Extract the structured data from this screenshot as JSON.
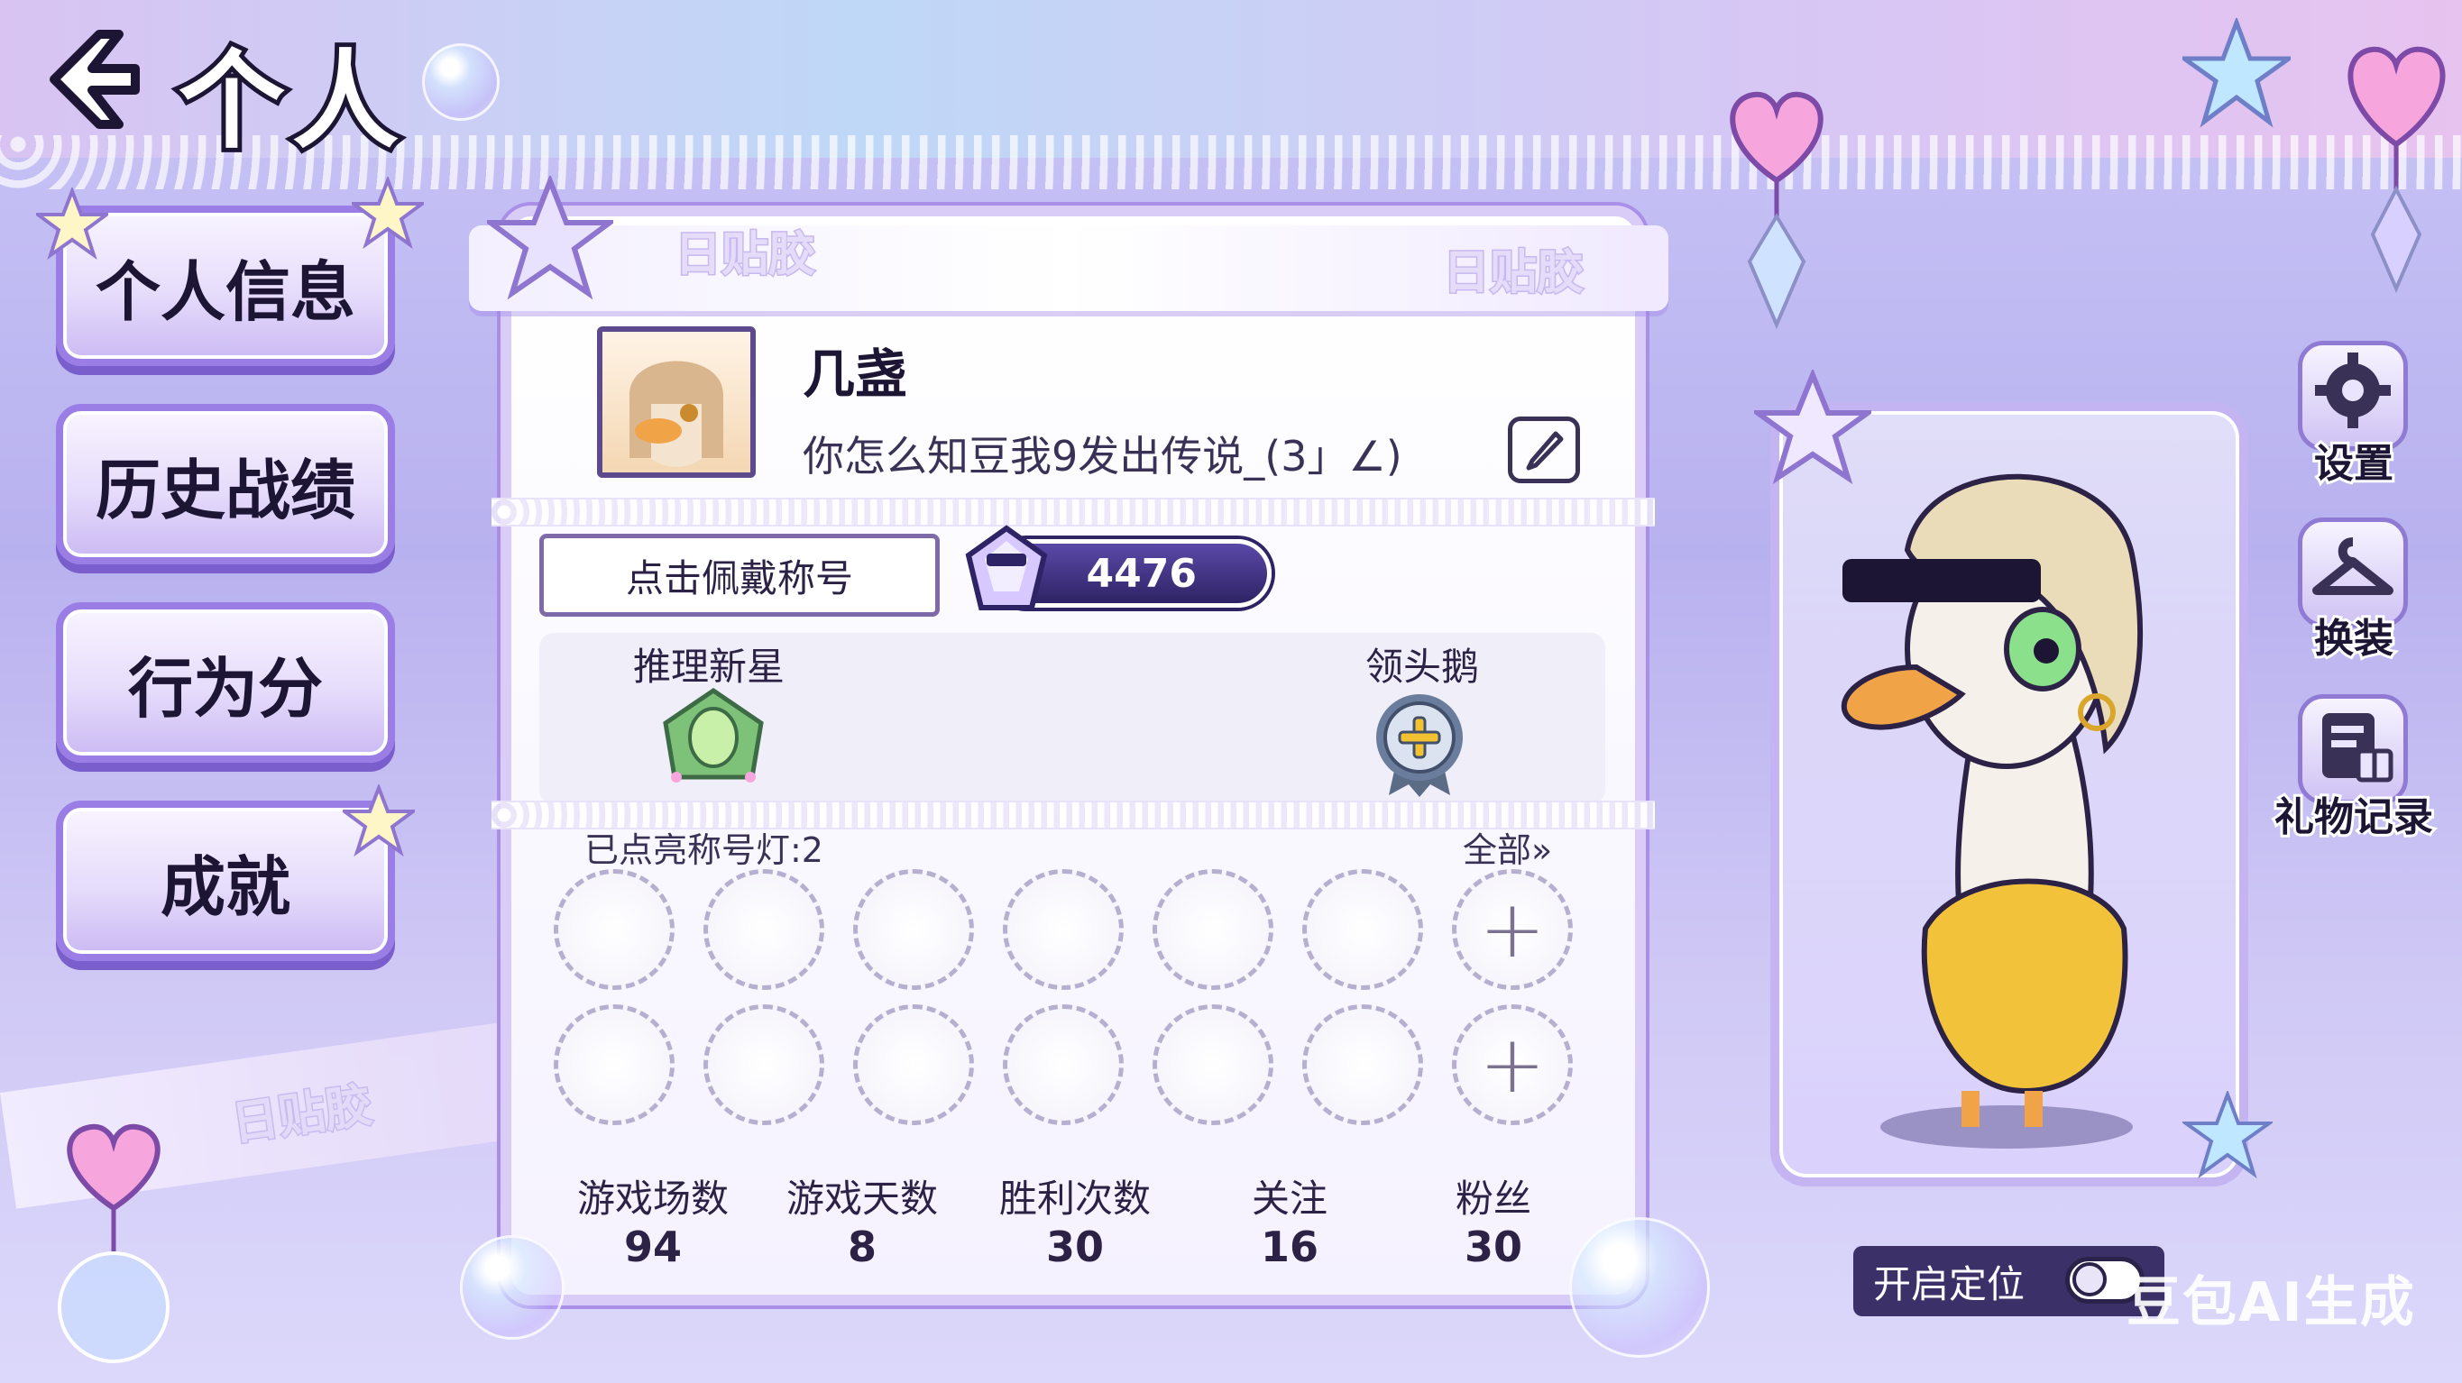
{
  "header": {
    "title": "个人"
  },
  "menu": {
    "items": [
      {
        "label": "个人信息"
      },
      {
        "label": "历史战绩"
      },
      {
        "label": "行为分"
      },
      {
        "label": "成就"
      }
    ]
  },
  "decor": {
    "tape_text": "日贴胶"
  },
  "profile": {
    "name": "几盏",
    "signature": "你怎么知豆我9发出传说_(3」∠)",
    "wear_title_button": "点击佩戴称号",
    "score": "4476"
  },
  "badges": [
    {
      "label": "推理新星"
    },
    {
      "label": "领头鹅"
    }
  ],
  "title_lights": {
    "label": "已点亮称号灯:2",
    "all_link": "全部»",
    "add_symbol": "+"
  },
  "stats": [
    {
      "label": "游戏场数",
      "value": "94"
    },
    {
      "label": "游戏天数",
      "value": "8"
    },
    {
      "label": "胜利次数",
      "value": "30"
    },
    {
      "label": "关注",
      "value": "16"
    },
    {
      "label": "粉丝",
      "value": "30"
    }
  ],
  "side_actions": [
    {
      "label": "设置",
      "icon": "gear-icon"
    },
    {
      "label": "换装",
      "icon": "hanger-icon"
    },
    {
      "label": "礼物记录",
      "icon": "gift-record-icon"
    }
  ],
  "location": {
    "label": "开启定位",
    "enabled": false
  },
  "watermark": "豆包AI生成",
  "colors": {
    "accent": "#9a7ee6",
    "dark": "#1c1533",
    "score_bg": "#2e2364"
  }
}
